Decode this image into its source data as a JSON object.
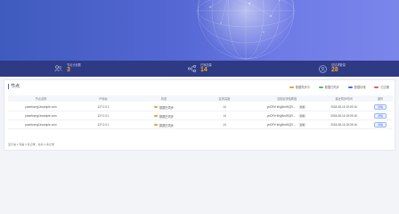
{
  "stats": [
    {
      "label": "节点计划数",
      "value": "3",
      "icon": "users-icon"
    },
    {
      "label": "已添加量",
      "value": "14",
      "icon": "network-icon"
    },
    {
      "label": "总请求数量",
      "value": "28",
      "icon": "user-icon"
    }
  ],
  "section": {
    "title": "节点"
  },
  "legend": [
    {
      "label": "数据同步中",
      "color": "#e8a33c"
    },
    {
      "label": "数据已同步",
      "color": "#5cb85c"
    },
    {
      "label": "数据存储",
      "color": "#3b6df5"
    },
    {
      "label": "已过期",
      "color": "#e06060"
    }
  ],
  "table": {
    "headers": [
      "节点名称",
      "IP地址",
      "状态",
      "区块高度",
      "当前区块哈希值",
      "最近同步时间",
      "操作"
    ],
    "rows": [
      {
        "name": "pawrfozng1example.com",
        "ip": "127.0.0.1",
        "status": "数据已同步",
        "height": "14",
        "hash": "ynDRr+kKgBmWQR...",
        "copy": "复制",
        "time": "2018-08-16 15:09:16",
        "action": "详情"
      },
      {
        "name": "pawrfozng1example.com",
        "ip": "127.0.0.1",
        "status": "数据已同步",
        "height": "14",
        "hash": "ynDRr+kKgBmWQR...",
        "copy": "复制",
        "time": "2018-08-16 15:09:16",
        "action": "详情"
      },
      {
        "name": "pawrfozng1example.com",
        "ip": "127.0.0.1",
        "status": "数据已同步",
        "height": "14",
        "hash": "ynDRr+kKgBmWQR...",
        "copy": "复制",
        "time": "2018-08-16 15:09:16",
        "action": "详情"
      }
    ]
  },
  "pager": {
    "text": "显示第 1 到第 3 条记录，总共 3 条记录"
  }
}
